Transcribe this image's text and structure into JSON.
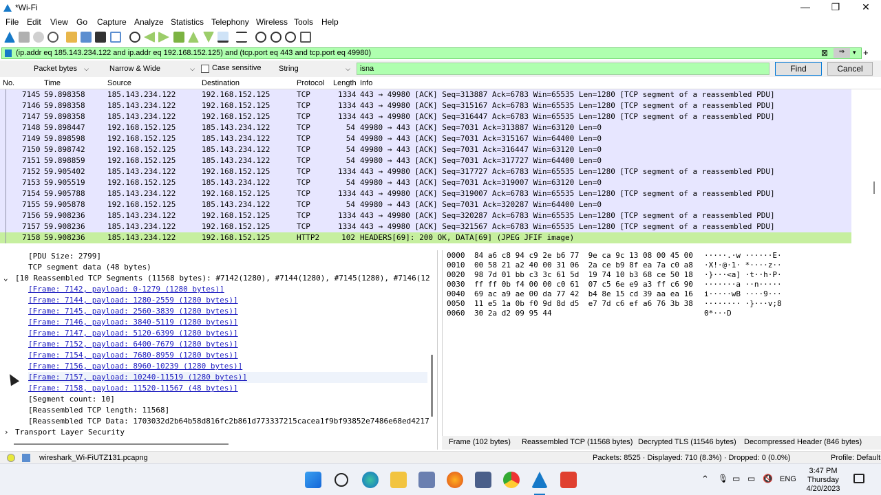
{
  "window": {
    "title": "*Wi-Fi",
    "minimize": "—",
    "maximize": "❐",
    "close": "✕"
  },
  "menu": [
    "File",
    "Edit",
    "View",
    "Go",
    "Capture",
    "Analyze",
    "Statistics",
    "Telephony",
    "Wireless",
    "Tools",
    "Help"
  ],
  "filter": {
    "value": "(ip.addr eq 185.143.234.122 and ip.addr eq 192.168.152.125) and (tcp.port eq 443 and tcp.port eq 49980)",
    "color": "#afffaf"
  },
  "find": {
    "search_in": "Packet bytes",
    "char_width": "Narrow & Wide",
    "case_sensitive_label": "Case sensitive",
    "type": "String",
    "query": "isna",
    "find_label": "Find",
    "cancel_label": "Cancel"
  },
  "packet_list": {
    "columns": [
      "No.",
      "Time",
      "Source",
      "Destination",
      "Protocol",
      "Length",
      "Info"
    ],
    "rows": [
      {
        "no": "7145",
        "time": "59.898358",
        "src": "185.143.234.122",
        "dst": "192.168.152.125",
        "proto": "TCP",
        "len": "1334",
        "info": "443 → 49980 [ACK] Seq=313887 Ack=6783 Win=65535 Len=1280 [TCP segment of a reassembled PDU]"
      },
      {
        "no": "7146",
        "time": "59.898358",
        "src": "185.143.234.122",
        "dst": "192.168.152.125",
        "proto": "TCP",
        "len": "1334",
        "info": "443 → 49980 [ACK] Seq=315167 Ack=6783 Win=65535 Len=1280 [TCP segment of a reassembled PDU]"
      },
      {
        "no": "7147",
        "time": "59.898358",
        "src": "185.143.234.122",
        "dst": "192.168.152.125",
        "proto": "TCP",
        "len": "1334",
        "info": "443 → 49980 [ACK] Seq=316447 Ack=6783 Win=65535 Len=1280 [TCP segment of a reassembled PDU]"
      },
      {
        "no": "7148",
        "time": "59.898447",
        "src": "192.168.152.125",
        "dst": "185.143.234.122",
        "proto": "TCP",
        "len": "54",
        "info": "49980 → 443 [ACK] Seq=7031 Ack=313887 Win=63120 Len=0"
      },
      {
        "no": "7149",
        "time": "59.898598",
        "src": "192.168.152.125",
        "dst": "185.143.234.122",
        "proto": "TCP",
        "len": "54",
        "info": "49980 → 443 [ACK] Seq=7031 Ack=315167 Win=64400 Len=0"
      },
      {
        "no": "7150",
        "time": "59.898742",
        "src": "192.168.152.125",
        "dst": "185.143.234.122",
        "proto": "TCP",
        "len": "54",
        "info": "49980 → 443 [ACK] Seq=7031 Ack=316447 Win=63120 Len=0"
      },
      {
        "no": "7151",
        "time": "59.898859",
        "src": "192.168.152.125",
        "dst": "185.143.234.122",
        "proto": "TCP",
        "len": "54",
        "info": "49980 → 443 [ACK] Seq=7031 Ack=317727 Win=64400 Len=0"
      },
      {
        "no": "7152",
        "time": "59.905402",
        "src": "185.143.234.122",
        "dst": "192.168.152.125",
        "proto": "TCP",
        "len": "1334",
        "info": "443 → 49980 [ACK] Seq=317727 Ack=6783 Win=65535 Len=1280 [TCP segment of a reassembled PDU]"
      },
      {
        "no": "7153",
        "time": "59.905519",
        "src": "192.168.152.125",
        "dst": "185.143.234.122",
        "proto": "TCP",
        "len": "54",
        "info": "49980 → 443 [ACK] Seq=7031 Ack=319007 Win=63120 Len=0"
      },
      {
        "no": "7154",
        "time": "59.905788",
        "src": "185.143.234.122",
        "dst": "192.168.152.125",
        "proto": "TCP",
        "len": "1334",
        "info": "443 → 49980 [ACK] Seq=319007 Ack=6783 Win=65535 Len=1280 [TCP segment of a reassembled PDU]"
      },
      {
        "no": "7155",
        "time": "59.905878",
        "src": "192.168.152.125",
        "dst": "185.143.234.122",
        "proto": "TCP",
        "len": "54",
        "info": "49980 → 443 [ACK] Seq=7031 Ack=320287 Win=64400 Len=0"
      },
      {
        "no": "7156",
        "time": "59.908236",
        "src": "185.143.234.122",
        "dst": "192.168.152.125",
        "proto": "TCP",
        "len": "1334",
        "info": "443 → 49980 [ACK] Seq=320287 Ack=6783 Win=65535 Len=1280 [TCP segment of a reassembled PDU]"
      },
      {
        "no": "7157",
        "time": "59.908236",
        "src": "185.143.234.122",
        "dst": "192.168.152.125",
        "proto": "TCP",
        "len": "1334",
        "info": "443 → 49980 [ACK] Seq=321567 Ack=6783 Win=65535 Len=1280 [TCP segment of a reassembled PDU]"
      },
      {
        "no": "7158",
        "time": "59.908236",
        "src": "185.143.234.122",
        "dst": "192.168.152.125",
        "proto": "HTTP2",
        "len": "102",
        "info": "HEADERS[69]: 200 OK, DATA[69] (JPEG JFIF image)"
      }
    ]
  },
  "details": {
    "pdu_size": "[PDU Size: 2799]",
    "tcp_segment_data": "TCP segment data (48 bytes)",
    "reassembled_header": "[10 Reassembled TCP Segments (11568 bytes): #7142(1280), #7144(1280), #7145(1280), #7146(12",
    "frames": [
      "[Frame: 7142, payload: 0-1279 (1280 bytes)]",
      "[Frame: 7144, payload: 1280-2559 (1280 bytes)]",
      "[Frame: 7145, payload: 2560-3839 (1280 bytes)]",
      "[Frame: 7146, payload: 3840-5119 (1280 bytes)]",
      "[Frame: 7147, payload: 5120-6399 (1280 bytes)]",
      "[Frame: 7152, payload: 6400-7679 (1280 bytes)]",
      "[Frame: 7154, payload: 7680-8959 (1280 bytes)]",
      "[Frame: 7156, payload: 8960-10239 (1280 bytes)]",
      "[Frame: 7157, payload: 10240-11519 (1280 bytes)]",
      "[Frame: 7158, payload: 11520-11567 (48 bytes)]"
    ],
    "segment_count": "[Segment count: 10]",
    "reassembled_length": "[Reassembled TCP length: 11568]",
    "reassembled_data": "[Reassembled TCP Data: 1703032d2b64b58d816fc2b861d773337215cacea1f9bf93852e7486e68ed4217",
    "tls": "Transport Layer Security"
  },
  "hex": [
    {
      "off": "0000",
      "bytes": "84 a6 c8 94 c9 2e b6 77  9e ca 9c 13 08 00 45 00",
      "ascii": "·····.·w ······E·"
    },
    {
      "off": "0010",
      "bytes": "00 58 21 a2 40 00 31 06  2a ce b9 8f ea 7a c0 a8",
      "ascii": "·X!·@·1· *····z··"
    },
    {
      "off": "0020",
      "bytes": "98 7d 01 bb c3 3c 61 5d  19 74 10 b3 68 ce 50 18",
      "ascii": "·}···<a] ·t··h·P·"
    },
    {
      "off": "0030",
      "bytes": "ff ff 0b f4 00 00 c0 61  07 c5 6e e9 a3 ff c6 90",
      "ascii": "·······a ··n·····"
    },
    {
      "off": "0040",
      "bytes": "69 ac a9 ae 00 da 77 42  b4 8e 15 cd 39 aa ea 16",
      "ascii": "i·····wB ····9···"
    },
    {
      "off": "0050",
      "bytes": "11 e5 1a 0b f0 9d 8d d5  e7 7d c6 ef a6 76 3b 38",
      "ascii": "········ ·}···v;8"
    },
    {
      "off": "0060",
      "bytes": "30 2a d2 09 95 44",
      "ascii": "0*···D"
    }
  ],
  "byte_tabs": [
    "Frame (102 bytes)",
    "Reassembled TCP (11568 bytes)",
    "Decrypted TLS (11546 bytes)",
    "Decompressed Header (846 bytes)"
  ],
  "status": {
    "file": "wireshark_Wi-FiUTZ131.pcapng",
    "stats": "Packets: 8525 · Displayed: 710 (8.3%) · Dropped: 0 (0.0%)",
    "profile": "Profile: Default"
  },
  "taskbar": {
    "lang": "ENG",
    "time": "3:47 PM",
    "day": "Thursday",
    "date": "4/20/2023"
  }
}
